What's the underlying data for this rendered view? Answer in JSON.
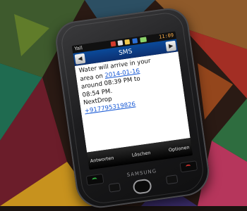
{
  "status_bar": {
    "signal_label": "Yall",
    "time": "11:09"
  },
  "sms_screen": {
    "title": "SMS",
    "prev_glyph": "◀",
    "next_glyph": "▶",
    "message": {
      "line1": "Water will arrive in your",
      "line2_prefix": "area on ",
      "date": "2014-01-16",
      "line3": "around 08:39 PM to",
      "line4": "08:54 PM.",
      "sender_name": "NextDrop",
      "sender_number": "+917795319826"
    },
    "softkeys": {
      "left": "Antworten",
      "center": "Löschen",
      "right": "Optionen"
    }
  },
  "phone": {
    "brand": "SAMSUNG"
  },
  "colors": {
    "header_blue": "#0d3070",
    "link_blue": "#1a5bd6",
    "status_orange": "#ffb04a"
  }
}
